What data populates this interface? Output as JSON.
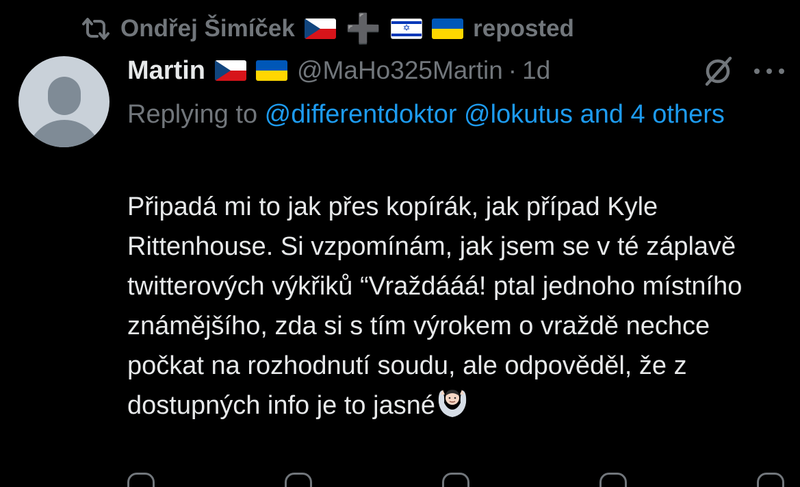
{
  "repost": {
    "icon": "repost-icon",
    "name": "Ondřej Šimíček",
    "plus": "➕",
    "label": "reposted"
  },
  "author": {
    "name": "Martin",
    "handle": "@MaHo325Martin",
    "separator": "·",
    "time": "1d"
  },
  "reply": {
    "prefix": "Replying to ",
    "mention1": "@differentdoktor",
    "mention2": "@lokutus",
    "suffix": "and 4 others"
  },
  "tweet": {
    "text": "Připadá mi to jak přes kopírák, jak případ Kyle Rittenhouse. Si vzpomínám, jak jsem se v té záplavě twitterových výkřiků “Vraždááá! ptal jednoho místního známějšího, zda si s tím výrokem o vraždě nechce počkat na rozhodnutí soudu, ale odpověděl, že z dostupných info je to jasné",
    "emoji": "shrug-emoji"
  },
  "icons": {
    "grok": "grok-icon",
    "more": "more-icon"
  },
  "colors": {
    "background": "#000000",
    "text": "#e7e9ea",
    "secondary": "#71767b",
    "link": "#1d9bf0"
  }
}
